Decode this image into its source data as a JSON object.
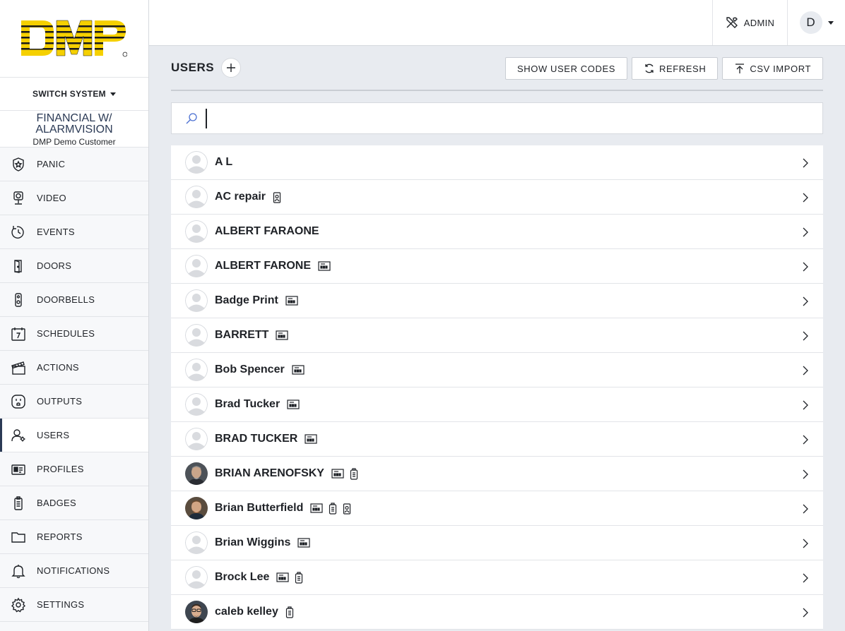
{
  "brand": {
    "logo_text": "DMP"
  },
  "sidebar": {
    "switch_label": "SWITCH SYSTEM",
    "system_title": "FINANCIAL W/ ALARMVISION",
    "system_customer": "DMP Demo Customer",
    "items": [
      {
        "label": "PANIC",
        "icon": "panic-icon"
      },
      {
        "label": "VIDEO",
        "icon": "video-icon"
      },
      {
        "label": "EVENTS",
        "icon": "events-icon"
      },
      {
        "label": "DOORS",
        "icon": "door-icon"
      },
      {
        "label": "DOORBELLS",
        "icon": "doorbell-icon"
      },
      {
        "label": "SCHEDULES",
        "icon": "calendar-icon"
      },
      {
        "label": "ACTIONS",
        "icon": "clapperboard-icon"
      },
      {
        "label": "OUTPUTS",
        "icon": "outlet-icon"
      },
      {
        "label": "USERS",
        "icon": "users-icon",
        "active": true
      },
      {
        "label": "PROFILES",
        "icon": "profile-card-icon"
      },
      {
        "label": "BADGES",
        "icon": "badge-icon"
      },
      {
        "label": "REPORTS",
        "icon": "folder-icon"
      },
      {
        "label": "NOTIFICATIONS",
        "icon": "bell-icon"
      },
      {
        "label": "SETTINGS",
        "icon": "gear-icon"
      }
    ]
  },
  "header": {
    "admin_label": "ADMIN",
    "user_initial": "D"
  },
  "page": {
    "title": "USERS",
    "buttons": {
      "show_codes": "SHOW USER CODES",
      "refresh": "REFRESH",
      "csv_import": "CSV IMPORT"
    },
    "search": {
      "value": "",
      "placeholder": ""
    }
  },
  "colors": {
    "accent": "#2b3a55",
    "logo_yellow": "#f5d000",
    "background": "#e8ebf0"
  },
  "users": [
    {
      "name": "A L",
      "photo": false,
      "badges": []
    },
    {
      "name": "AC repair",
      "photo": false,
      "badges": [
        "badge"
      ]
    },
    {
      "name": "ALBERT FARAONE",
      "photo": false,
      "badges": []
    },
    {
      "name": "ALBERT FARONE",
      "photo": false,
      "badges": [
        "card"
      ]
    },
    {
      "name": "Badge Print",
      "photo": false,
      "badges": [
        "card"
      ]
    },
    {
      "name": "BARRETT",
      "photo": false,
      "badges": [
        "card"
      ]
    },
    {
      "name": "Bob Spencer",
      "photo": false,
      "badges": [
        "card"
      ]
    },
    {
      "name": "Brad Tucker",
      "photo": false,
      "badges": [
        "card"
      ]
    },
    {
      "name": "BRAD TUCKER",
      "photo": false,
      "badges": [
        "card"
      ]
    },
    {
      "name": "BRIAN ARENOFSKY",
      "photo": true,
      "photo_style": "gray",
      "badges": [
        "card",
        "fob"
      ]
    },
    {
      "name": "Brian Butterfield",
      "photo": true,
      "photo_style": "brown",
      "badges": [
        "card",
        "fob",
        "badge"
      ]
    },
    {
      "name": "Brian Wiggins",
      "photo": false,
      "badges": [
        "card"
      ]
    },
    {
      "name": "Brock Lee",
      "photo": false,
      "badges": [
        "card",
        "fob"
      ]
    },
    {
      "name": "caleb kelley",
      "photo": true,
      "photo_style": "glasses",
      "badges": [
        "fob"
      ]
    }
  ]
}
